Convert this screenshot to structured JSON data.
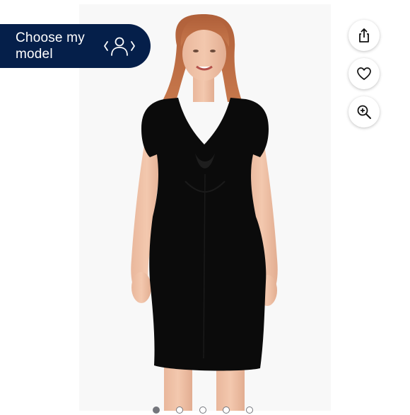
{
  "choose_model": {
    "label": "Choose my model",
    "icon": "person-chevrons-icon"
  },
  "actions": [
    {
      "name": "share-button",
      "icon": "share-icon"
    },
    {
      "name": "favorite-button",
      "icon": "heart-icon"
    },
    {
      "name": "zoom-button",
      "icon": "zoom-in-icon"
    }
  ],
  "carousel": {
    "total_dots": 5,
    "active_index": 0
  },
  "colors": {
    "banner": "#051f4a",
    "dot": "#74767c"
  }
}
